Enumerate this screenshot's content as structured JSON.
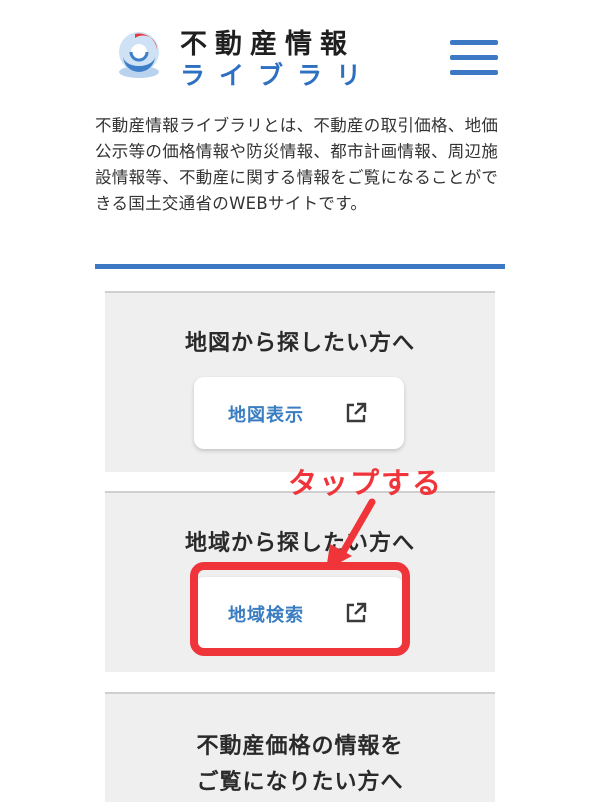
{
  "header": {
    "logo_line1": "不動産情報",
    "logo_line2": "ライブラリ",
    "menu_icon": "hamburger-menu-icon",
    "logo_icon": "mlit-logo-icon"
  },
  "intro": {
    "text": "不動産情報ライブラリとは、不動産の取引価格、地価公示等の価格情報や防災情報、都市計画情報、周辺施設情報等、不動産に関する情報をご覧になることができる国土交通省のWEBサイトです。"
  },
  "cards": [
    {
      "title": "地図から探したい方へ",
      "button_label": "地図表示",
      "button_icon": "external-link-icon"
    },
    {
      "title": "地域から探したい方へ",
      "button_label": "地域検索",
      "button_icon": "external-link-icon"
    },
    {
      "title_line1": "不動産価格の情報を",
      "title_line2": "ご覧になりたい方へ"
    }
  ],
  "annotation": {
    "label": "タップする",
    "color": "#f0353a"
  },
  "colors": {
    "accent": "#3d78c4",
    "button_text": "#3a7dc0",
    "card_bg": "#efefef"
  }
}
